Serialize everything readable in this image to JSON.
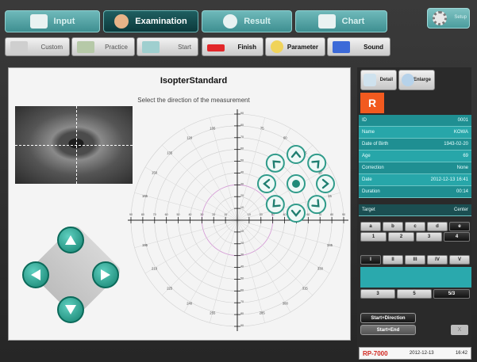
{
  "tabs": [
    {
      "label": "Input",
      "active": false
    },
    {
      "label": "Examination",
      "active": true
    },
    {
      "label": "Result",
      "active": false
    },
    {
      "label": "Chart",
      "active": false
    }
  ],
  "settings_label": "Setup",
  "toolbar": {
    "custom": "Custom",
    "practice": "Practice",
    "start": "Start",
    "finish": "Finish",
    "parameter": "Parameter",
    "sound": "Sound"
  },
  "main": {
    "title": "IsopterStandard",
    "subtitle": "Select the direction of the measurement"
  },
  "chart_data": {
    "type": "polar",
    "radial_labels_deg": [
      "90",
      "80",
      "70",
      "60",
      "50",
      "40",
      "30",
      "20",
      "10"
    ],
    "angle_labels": [
      "105",
      "120",
      "135",
      "150",
      "165",
      "195",
      "210",
      "225",
      "240",
      "255",
      "285",
      "300",
      "315",
      "330",
      "345",
      "15",
      "30",
      "45",
      "60",
      "75"
    ]
  },
  "right_panel": {
    "detail_label": "Detail",
    "enlarge_label": "Enlarge",
    "eye": "R",
    "info": [
      {
        "key": "ID",
        "value": "0001"
      },
      {
        "key": "Name",
        "value": "KOWA"
      },
      {
        "key": "Date of Birth",
        "value": "1943-02-20"
      },
      {
        "key": "Age",
        "value": "69"
      },
      {
        "key": "Correction",
        "value": "None"
      },
      {
        "key": "Date",
        "value": "2012-12-13 16:41"
      },
      {
        "key": "Duration",
        "value": "00:14"
      }
    ],
    "target": {
      "key": "Target",
      "value": "Center"
    },
    "letters": [
      "a",
      "b",
      "c",
      "d",
      "e"
    ],
    "numbers": [
      "1",
      "2",
      "3",
      "4"
    ],
    "romans": [
      "I",
      "II",
      "III",
      "IV",
      "V"
    ],
    "speeds": [
      "3",
      "5",
      "5/3"
    ],
    "start_direction": "Start+Direction",
    "start_end": "Start+End",
    "x_label": "X"
  },
  "footer": {
    "brand": "RP-7000",
    "date": "2012-12-13",
    "time": "16:42"
  }
}
